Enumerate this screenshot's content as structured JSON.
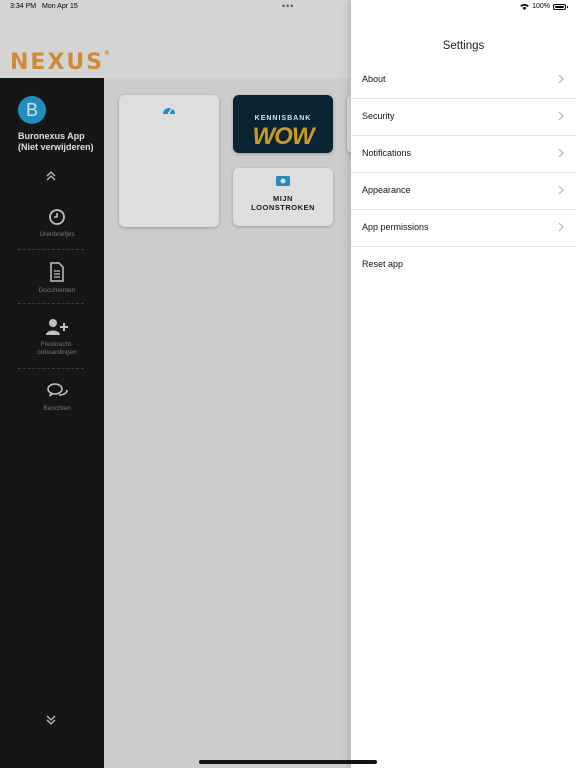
{
  "status_bar": {
    "time": "3:34 PM",
    "date": "Mon Apr 15",
    "battery": "100%"
  },
  "header": {
    "logo_text": "NEXUS",
    "logo_mark": "®"
  },
  "sidebar": {
    "avatar_letter": "B",
    "app_name": "Buronexus App (Niet verwijderen)",
    "items": [
      {
        "label": "Urenbriefjes",
        "icon": "clock-icon"
      },
      {
        "label": "Documenten",
        "icon": "document-icon"
      },
      {
        "label": "Flexkracht-onboardingen",
        "icon": "add-user-icon"
      },
      {
        "label": "Berichten",
        "icon": "chat-icon"
      }
    ]
  },
  "tiles": {
    "kennisbank_title": "KENNISBANK",
    "kennisbank_wow": "WOW",
    "loonstroken_line1": "MIJN",
    "loonstroken_line2": "LOONSTROKEN"
  },
  "settings": {
    "title": "Settings",
    "items": [
      {
        "label": "About",
        "has_chevron": true
      },
      {
        "label": "Security",
        "has_chevron": true
      },
      {
        "label": "Notifications",
        "has_chevron": true
      },
      {
        "label": "Appearance",
        "has_chevron": true
      },
      {
        "label": "App permissions",
        "has_chevron": true
      },
      {
        "label": "Reset app",
        "has_chevron": false
      }
    ]
  },
  "colors": {
    "accent": "#29a3dc",
    "logo": "#f0a040",
    "sidebar_bg": "#1a1a1a",
    "kennisbank_bg": "#0d2a3a"
  }
}
